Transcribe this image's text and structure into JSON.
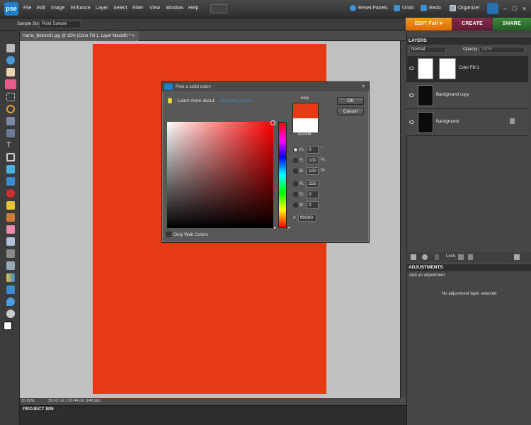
{
  "app": {
    "logo": "pse"
  },
  "menu": [
    "File",
    "Edit",
    "Image",
    "Enhance",
    "Layer",
    "Select",
    "Filter",
    "View",
    "Window",
    "Help"
  ],
  "topbar": {
    "reset": "Reset Panels",
    "undo": "Undo",
    "redo": "Redo",
    "organizer": "Organizer"
  },
  "options": {
    "sample_label": "Sample Size:",
    "sample_value": "Point Sample"
  },
  "modes": {
    "edit": "EDIT Full",
    "create": "CREATE",
    "share": "SHARE"
  },
  "document": {
    "tab": "Harris_Before01.jpg @ 15% (Color Fill 1, Layer Mask/8) *",
    "zoom": "15.83%",
    "size": "39.62 cm x 59.44 cm (240 ppi)"
  },
  "projectbin": "PROJECT BIN",
  "layers": {
    "header": "LAYERS",
    "blend": "Normal",
    "opacity_label": "Opacity:",
    "opacity": "100%",
    "lock": "Lock:",
    "items": [
      {
        "name": "Color Fill 1"
      },
      {
        "name": "Background copy"
      },
      {
        "name": "Background"
      }
    ]
  },
  "adjustments": {
    "header": "ADJUSTMENTS",
    "add": "Add an adjustment",
    "empty": "No adjustment layer selected"
  },
  "dialog": {
    "title": "Pick a solid color:",
    "learn": "Learn more about:",
    "learn_link": "Choosing colors",
    "ok": "OK",
    "cancel": "Cancel",
    "new_label": "new",
    "current_label": "current",
    "new_color": "#e63a14",
    "current_color": "#ffffff",
    "web_colors": "Only Web Colors",
    "fields": {
      "H": "0",
      "S": "100",
      "B": "100",
      "R": "255",
      "G": "0",
      "Bl": "0",
      "hex": "ff0000"
    },
    "units": {
      "deg": "°",
      "pct": "%"
    },
    "labels": {
      "H": "H:",
      "S": "S:",
      "B": "B:",
      "R": "R:",
      "G": "G:",
      "Bl": "B:",
      "hash": "#"
    }
  }
}
